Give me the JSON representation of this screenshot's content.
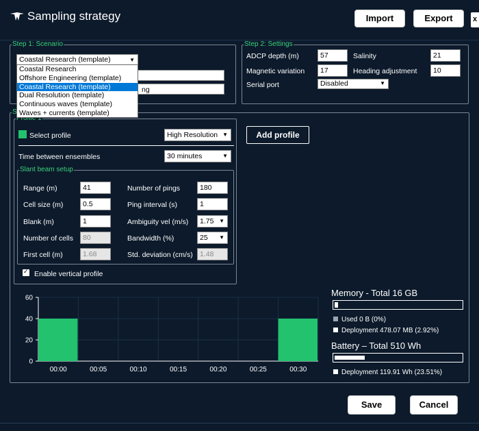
{
  "window": {
    "title": "Sampling strategy"
  },
  "toolbar": {
    "import_label": "Import",
    "export_label": "Export",
    "close_glyph": "x"
  },
  "step1": {
    "legend": "Step 1: Scenario",
    "scenario_selected": "Coastal Research (template)",
    "dropdown_options": [
      "Coastal Research",
      "Offshore Engineering (template)",
      "Coastal Research (template)",
      "Dual Resolution (template)",
      "Continuous waves (template)",
      "Waves + currents (template)"
    ],
    "selected_index": 2,
    "field2_partial_text": "ng"
  },
  "step2": {
    "legend": "Step 2: Settings",
    "adcp_depth_label": "ADCP depth (m)",
    "adcp_depth_value": "57",
    "salinity_label": "Salinity",
    "salinity_value": "21",
    "mag_var_label": "Magnetic variation",
    "mag_var_value": "17",
    "heading_adj_label": "Heading adjustment",
    "heading_adj_value": "10",
    "serial_port_label": "Serial port",
    "serial_port_value": "Disabled"
  },
  "step3": {
    "legend_partial": "S"
  },
  "profile": {
    "legend": "Profile 1",
    "select_profile_label": "Select profile",
    "profile_color": "#22c26e",
    "resolution_value": "High Resolution",
    "time_between_label": "Time between ensembles",
    "time_between_value": "30 minutes",
    "enable_vertical_label": "Enable vertical profile",
    "enable_vertical_checked": true
  },
  "slant": {
    "legend": "Slant beam setup",
    "range_label": "Range (m)",
    "range_value": "41",
    "cell_size_label": "Cell size (m)",
    "cell_size_value": "0.5",
    "blank_label": "Blank (m)",
    "blank_value": "1",
    "num_cells_label": "Number of cells",
    "num_cells_value": "80",
    "first_cell_label": "First cell (m)",
    "first_cell_value": "1.68",
    "num_pings_label": "Number of pings",
    "num_pings_value": "180",
    "ping_interval_label": "Ping interval (s)",
    "ping_interval_value": "1",
    "ambiguity_label": "Ambiguity vel (m/s)",
    "ambiguity_value": "1.75",
    "bandwidth_label": "Bandwidth (%)",
    "bandwidth_value": "25",
    "std_dev_label": "Std. deviation (cm/s)",
    "std_dev_value": "1.48"
  },
  "add_profile_label": "Add profile",
  "chart_data": {
    "type": "bar",
    "categories": [
      "00:00",
      "00:05",
      "00:10",
      "00:15",
      "00:20",
      "00:25",
      "00:30"
    ],
    "bars": [
      {
        "x": "00:00",
        "value": 40
      },
      {
        "x": "00:30",
        "value": 40
      }
    ],
    "ylim": [
      0,
      60
    ],
    "yticks": [
      0,
      20,
      40,
      60
    ],
    "bar_color": "#22c26e",
    "grid": true
  },
  "memory": {
    "title": "Memory - Total 16 GB",
    "used_fraction": 0.0,
    "deployment_fraction": 0.0292,
    "used_label": "Used 0 B (0%)",
    "deployment_label": "Deployment 478.07 MB (2.92%)"
  },
  "battery": {
    "title": "Battery – Total  510  Wh",
    "deployment_fraction": 0.2351,
    "deployment_label": "Deployment 119.91 Wh (23.51%)"
  },
  "footer": {
    "save_label": "Save",
    "cancel_label": "Cancel"
  }
}
